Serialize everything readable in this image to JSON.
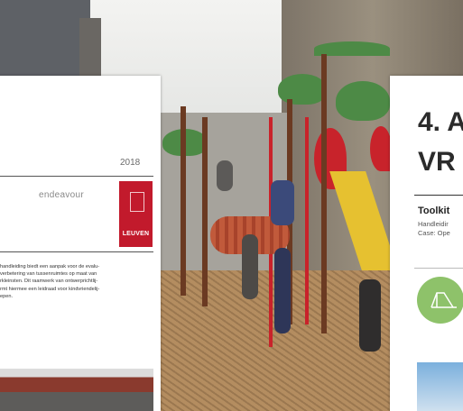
{
  "left_card": {
    "year": "2018",
    "subtitle": "endeavour",
    "logo": {
      "name": "LEUVEN",
      "tagline": ""
    },
    "body_lines": [
      "handleiding biedt een aanpak voor de evalu-",
      "verbetering van tussenruimtes op maat van",
      "rkleinsten. Dit raamwerk van ontwerprichtlij-",
      "rmt hiermee een leidraad voor kindvriendelij-",
      "epen."
    ]
  },
  "right_card": {
    "title_line1": "4. A",
    "title_line2": "VR",
    "toolkit_label": "Toolkit",
    "sub_line1": "Handleidir",
    "sub_line2": "Case: Ope"
  },
  "colors": {
    "logo_red": "#c21a2c",
    "accent_green": "#8ec26a",
    "card_white": "#ffffff"
  }
}
